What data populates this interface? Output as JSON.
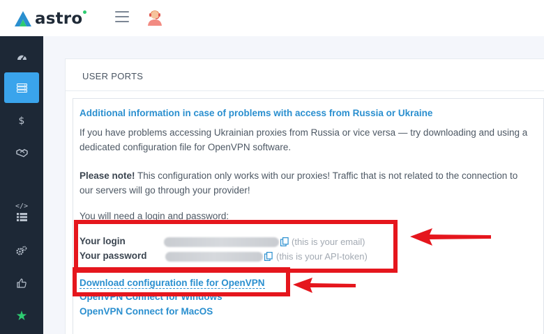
{
  "brand": {
    "name": "astro"
  },
  "header": {
    "menu_icon": "hamburger-icon",
    "avatar_icon": "support-agent-avatar"
  },
  "sidebar": {
    "items": [
      {
        "name": "dashboard-icon",
        "active": false
      },
      {
        "name": "ports-icon",
        "active": true
      },
      {
        "name": "dollar-icon",
        "active": false
      },
      {
        "name": "handshake-icon",
        "active": false
      },
      {
        "name": "code-icon",
        "active": false
      },
      {
        "name": "list-icon",
        "active": false
      },
      {
        "name": "settings-icon",
        "active": false
      },
      {
        "name": "thumbs-up-icon",
        "active": false
      },
      {
        "name": "star-icon",
        "active": false
      }
    ],
    "dollar_glyph": "$",
    "star_glyph": "★",
    "code_glyph": "</>"
  },
  "card": {
    "title": "USER PORTS"
  },
  "info": {
    "title": "Additional information in case of problems with access from Russia or Ukraine",
    "para1": "If you have problems accessing Ukrainian proxies from Russia or vice versa — try downloading and using a dedicated configuration file for OpenVPN software.",
    "note_bold": "Please note!",
    "note_text": " This configuration only works with our proxies! Traffic that is not related to the connection to our servers will go through your provider!",
    "need": "You will need a login and password:",
    "login_label": "Your login",
    "login_hint": "(this is your email)",
    "password_label": "Your password",
    "password_hint": "(this is your API-token)",
    "download_link": "Download configuration file for OpenVPN",
    "windows_link": "OpenVPN Connect for Windows",
    "macos_link": "OpenVPN Connect for MacOS"
  },
  "colors": {
    "accent": "#2a8fcf",
    "sidebar_bg": "#1d2836",
    "sidebar_active": "#3aa4ec",
    "annotation_red": "#e5161d"
  }
}
